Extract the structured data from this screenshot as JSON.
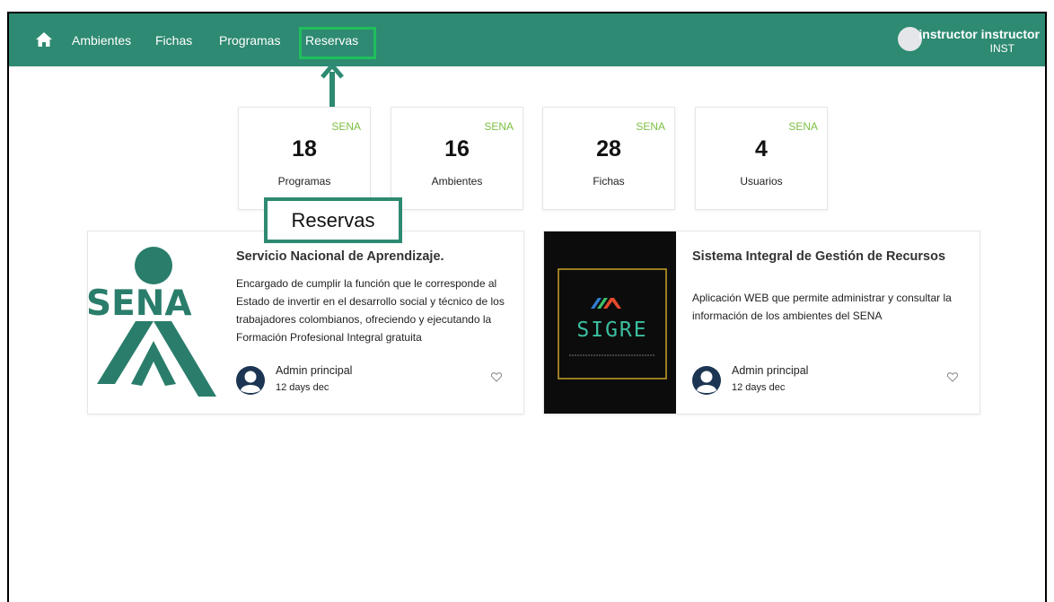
{
  "navbar": {
    "items": [
      {
        "label": "Ambientes"
      },
      {
        "label": "Fichas"
      },
      {
        "label": "Programas"
      },
      {
        "label": "Reservas"
      }
    ],
    "user": {
      "name": "instructor instructor",
      "role": "INST"
    }
  },
  "stats": [
    {
      "tag": "SENA",
      "value": "18",
      "label": "Programas"
    },
    {
      "tag": "SENA",
      "value": "16",
      "label": "Ambientes"
    },
    {
      "tag": "SENA",
      "value": "28",
      "label": "Fichas"
    },
    {
      "tag": "SENA",
      "value": "4",
      "label": "Usuarios"
    }
  ],
  "cards": [
    {
      "title": "Servicio Nacional de Aprendizaje.",
      "text": "Encargado de cumplir la función que le corresponde al Estado de invertir en el desarrollo social y técnico de los trabajadores colombianos, ofreciendo y ejecutando la Formación Profesional Integral gratuita",
      "author": "Admin principal",
      "date": "12 days dec",
      "logo_text": "SENA"
    },
    {
      "title": "Sistema Integral de Gestión de Recursos",
      "text": "Aplicación WEB que permite administrar y consultar la información de los ambientes del SENA",
      "author": "Admin principal",
      "date": "12 days dec",
      "logo_text": "SIGRE"
    }
  ],
  "annotation": {
    "label": "Reservas"
  },
  "colors": {
    "navbar": "#2e8a72",
    "accent": "#7cc142",
    "highlight": "#1fbf5c"
  }
}
